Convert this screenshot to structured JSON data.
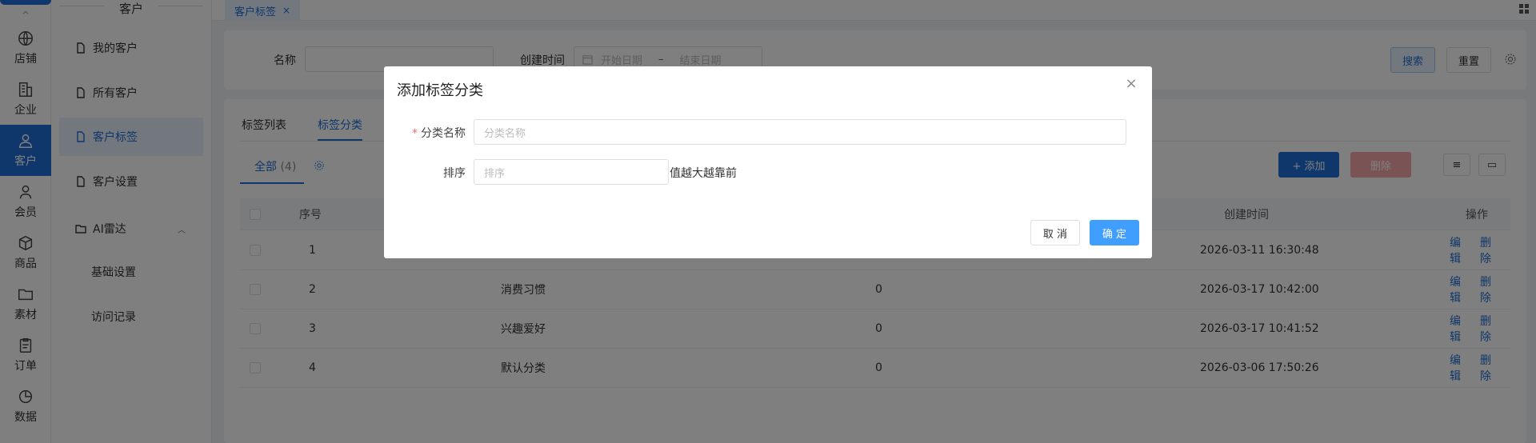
{
  "rail": {
    "items": [
      {
        "label": "店铺",
        "icon": "globe-icon"
      },
      {
        "label": "企业",
        "icon": "building-icon"
      },
      {
        "label": "客户",
        "icon": "user-icon",
        "active": true
      },
      {
        "label": "会员",
        "icon": "member-icon"
      },
      {
        "label": "商品",
        "icon": "box-icon"
      },
      {
        "label": "素材",
        "icon": "folder-icon"
      },
      {
        "label": "订单",
        "icon": "clipboard-icon"
      },
      {
        "label": "数据",
        "icon": "pie-chart-icon"
      }
    ],
    "collapse_glyph": "^"
  },
  "sidebar": {
    "title": "客户",
    "items": [
      {
        "label": "我的客户"
      },
      {
        "label": "所有客户"
      },
      {
        "label": "客户标签",
        "active": true
      },
      {
        "label": "客户设置"
      }
    ],
    "group": {
      "label": "AI雷达",
      "children": [
        "基础设置",
        "访问记录"
      ]
    }
  },
  "tabbar": {
    "tab": "客户标签",
    "close": "×"
  },
  "search": {
    "name_label": "名称",
    "date_label": "创建时间",
    "start_placeholder": "开始日期",
    "sep": "–",
    "end_placeholder": "结束日期",
    "search_btn": "搜索",
    "reset_btn": "重置"
  },
  "main": {
    "tabs": [
      "标签列表",
      "标签分类"
    ],
    "subtab": "全部",
    "subtab_count": "(4)",
    "add_btn": "+ 添加",
    "delete_btn": "删除",
    "columns": {
      "index": "序号",
      "created": "创建时间",
      "actions": "操作"
    },
    "rows": [
      {
        "index": "1",
        "name": "",
        "count": "",
        "created": "2026-03-11 16:30:48"
      },
      {
        "index": "2",
        "name": "消费习惯",
        "count": "0",
        "created": "2026-03-17 10:42:00"
      },
      {
        "index": "3",
        "name": "兴趣爱好",
        "count": "0",
        "created": "2026-03-17 10:41:52"
      },
      {
        "index": "4",
        "name": "默认分类",
        "count": "0",
        "created": "2026-03-06 17:50:26"
      }
    ],
    "edit": "编辑",
    "remove": "删除"
  },
  "dialog": {
    "title": "添加标签分类",
    "close": "×",
    "name_label": "分类名称",
    "name_placeholder": "分类名称",
    "sort_label": "排序",
    "sort_placeholder": "排序",
    "sort_hint": "值越大越靠前",
    "cancel": "取 消",
    "confirm": "确 定"
  },
  "colors": {
    "accent": "#1f6fd6",
    "danger": "#f56c6c"
  }
}
